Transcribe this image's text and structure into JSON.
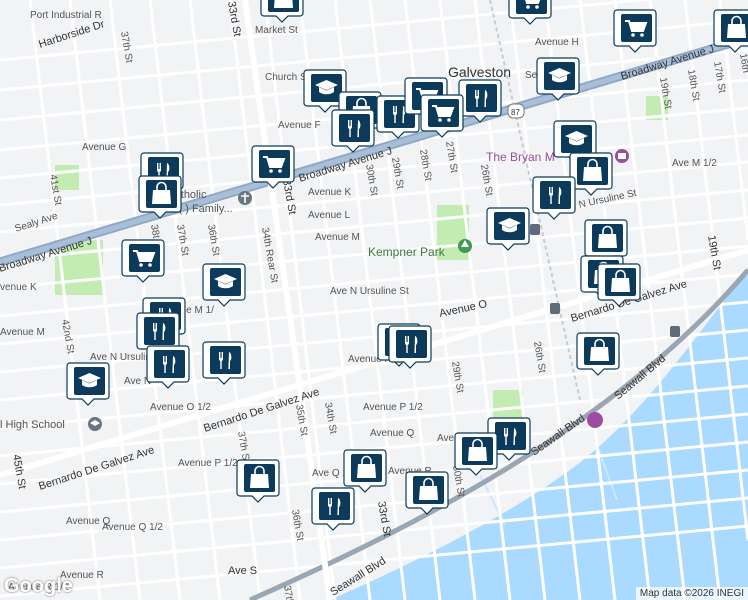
{
  "city_label": "Galveston",
  "places": {
    "kempner_park": "Kempner Park",
    "bryan_museum": "The Bryan M",
    "st_patrick": "St. P      Catholic",
    "st_patrick_line2": "Church (    ) Family...",
    "high_school": "l High School"
  },
  "streets": {
    "port_industrial": "Port Industrial R",
    "harborside": "Harborside Dr",
    "market": "Market St",
    "church": "Church St",
    "avenue_h": "Avenue H",
    "avenue_g": "Avenue G",
    "sealy1": "Sealy Av",
    "sealy2": "Sealy Ave",
    "avenue_f": "Avenue F",
    "broadway_j_top": "Broadway Avenue J",
    "broadway_top_right": "Broadway Avenue J",
    "broadway_left": "Broadway Avenue J",
    "avenue_k_top": "Avenue K",
    "avenue_l": "Avenue L",
    "avenue_m": "Avenue M",
    "avenue_m_half_right": "Ave M 1/2",
    "ave_n_ursuline": "Ave N Ursuline St",
    "ave_n_ursuline_right": "Ave N Ursuline St",
    "avenue_o": "Avenue O",
    "avenue_k_left": "venue K",
    "avenue_m_left": "Avenue M",
    "avenue_m_half_left": "nue M 1/",
    "ave_n_left": "Ave N Ursuline",
    "ave_n_short": "Ave N",
    "avenue_n_half": "Avenue N",
    "avenue_o_half": "Avenue O 1/2",
    "bernardo_center": "Bernardo De Galvez Ave",
    "bernardo_right": "Bernardo De Galvez Ave",
    "bernardo_left": "Bernardo De Galvez Ave",
    "avenue_p_half_left": "Avenue P 1/2",
    "avenue_p_half_center": "Avenue P 1/2",
    "avenue_q": "Avenue Q",
    "avenue_q_half_short": "Ave Q 1/2",
    "avenue_q_half_right": "Avenue Q 1/2",
    "avenue_r": "Avenue R",
    "avenue_q_left": "Avenue Q",
    "avenue_q_half_left": "Avenue Q 1/2",
    "avenue_r_left": "Avenue R",
    "avenue_r_half": "Avenue R 1/2",
    "ave_s": "Ave S",
    "seawall": "Seawall Blvd",
    "seawall2": "Seawall Blvd",
    "seawall3": "Seawall Blvd",
    "st_37th_top": "37th St",
    "st_33rd_top": "33rd St",
    "st_33rd_mid": "33rd St",
    "st_33rd_bottom": "33rd St",
    "st_30th": "30th St",
    "st_29th": "29th St",
    "st_28th": "28th St",
    "st_27th": "27th St",
    "st_26th": "26th St",
    "st_26th_low": "26th St",
    "st_29th_low": "29th St",
    "st_30th_low": "30th St",
    "st_34th_rear": "34th Rear St",
    "st_36th": "36th St",
    "st_37th": "37th St",
    "st_38th": "38t",
    "st_41st": "41st St",
    "st_42nd": "42nd St",
    "st_45th": "45th St",
    "st_35th": "35th St",
    "st_34th": "34th St",
    "st_37th_low": "37th S",
    "st_36th_low": "36th St",
    "st_19th": "19th St",
    "st_19th_top": "19th St",
    "st_18th": "18th St",
    "st_17th": "17th St",
    "st_16th": "16th",
    "st_37th_bottom": "37th",
    "hwy_87": "87"
  },
  "pins": [
    {
      "type": "shopping-cart-icon"
    },
    {
      "type": "school-icon"
    },
    {
      "type": "restaurant-icon"
    },
    {
      "type": "shopping-bag-icon"
    }
  ],
  "attribution": "Map data ©2026 INEGI",
  "logo": "Google",
  "colors": {
    "water": "#aadaff",
    "park": "#c3ecb2",
    "road": "#ffffff",
    "highway": "#8fa9c7",
    "pin_dark": "#0b3a5a"
  }
}
